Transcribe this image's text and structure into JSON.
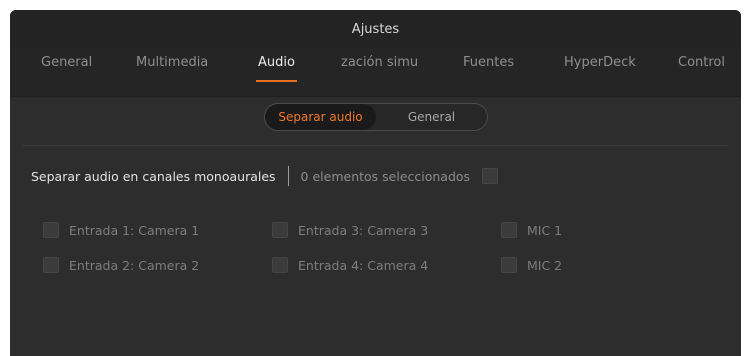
{
  "window": {
    "title": "Ajustes"
  },
  "tabs": [
    {
      "label": "General",
      "active": false
    },
    {
      "label": "Multimedia",
      "active": false
    },
    {
      "label": "Audio",
      "active": true
    },
    {
      "label": "zación simu",
      "active": false
    },
    {
      "label": "Fuentes",
      "active": false
    },
    {
      "label": "HyperDeck",
      "active": false
    },
    {
      "label": "Control",
      "active": false
    }
  ],
  "segmented": {
    "options": [
      {
        "label": "Separar audio",
        "active": true
      },
      {
        "label": "General",
        "active": false
      }
    ]
  },
  "split": {
    "title": "Separar audio en canales monoaurales",
    "selected_count": "0 elementos seleccionados",
    "inputs": [
      {
        "label": "Entrada 1: Camera 1",
        "checked": false
      },
      {
        "label": "Entrada 2: Camera 2",
        "checked": false
      },
      {
        "label": "Entrada 3: Camera 3",
        "checked": false
      },
      {
        "label": "Entrada 4: Camera 4",
        "checked": false
      },
      {
        "label": "MIC 1",
        "checked": false
      },
      {
        "label": "MIC 2",
        "checked": false
      }
    ]
  },
  "colors": {
    "accent": "#e9701e",
    "background": "#2d2d2d",
    "titlebar": "#232323"
  }
}
